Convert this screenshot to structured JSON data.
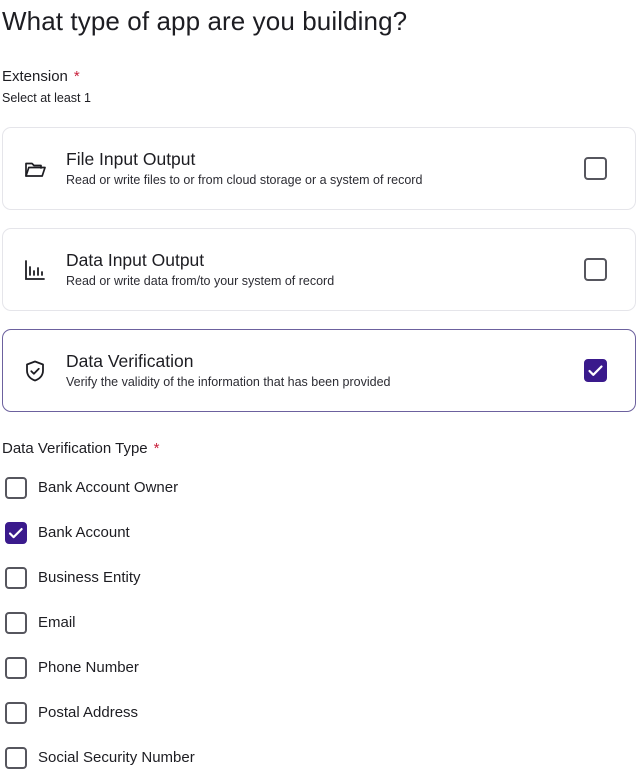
{
  "page": {
    "title": "What type of app are you building?"
  },
  "extension": {
    "label": "Extension",
    "required_mark": "*",
    "hint": "Select at least 1",
    "cards": [
      {
        "title": "File Input Output",
        "description": "Read or write files to or from cloud storage or a system of record",
        "icon": "folder-open-icon",
        "checked": false
      },
      {
        "title": "Data Input Output",
        "description": "Read or write data from/to your system of record",
        "icon": "bar-chart-icon",
        "checked": false
      },
      {
        "title": "Data Verification",
        "description": "Verify the validity of the information that has been provided",
        "icon": "shield-check-icon",
        "checked": true
      }
    ]
  },
  "verification_type": {
    "label": "Data Verification Type",
    "required_mark": "*",
    "options": [
      {
        "label": "Bank Account Owner",
        "checked": false
      },
      {
        "label": "Bank Account",
        "checked": true
      },
      {
        "label": "Business Entity",
        "checked": false
      },
      {
        "label": "Email",
        "checked": false
      },
      {
        "label": "Phone Number",
        "checked": false
      },
      {
        "label": "Postal Address",
        "checked": false
      },
      {
        "label": "Social Security Number",
        "checked": false
      }
    ]
  },
  "colors": {
    "accent": "#3a1a8c",
    "selected_border": "#6c619e",
    "required": "#c81f3a",
    "card_border": "#e5e5ea"
  }
}
